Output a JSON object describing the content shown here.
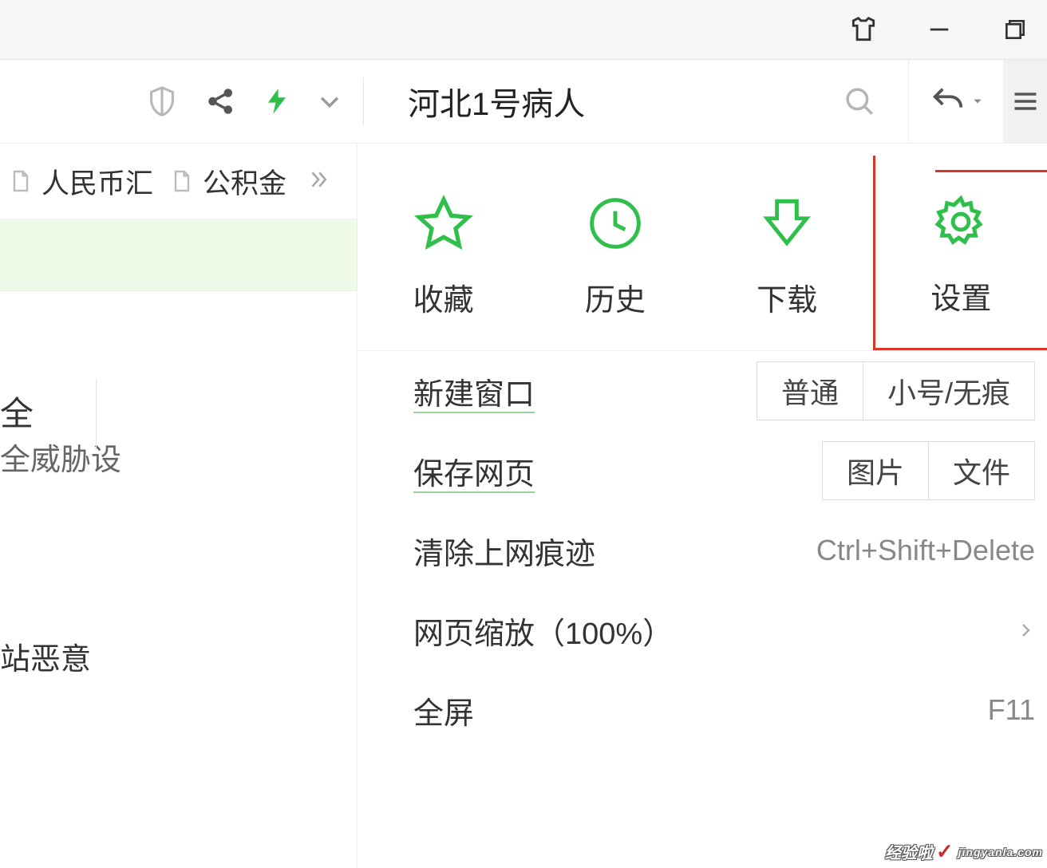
{
  "search": {
    "text": "河北1号病人"
  },
  "bookmarks": {
    "item1": "人民币汇",
    "item2": "公积金"
  },
  "side": {
    "heading_fragment": "全",
    "sub_fragment": "全威胁设",
    "lower_fragment": "站恶意"
  },
  "grid": {
    "favorites": "收藏",
    "history": "历史",
    "downloads": "下载",
    "settings": "设置"
  },
  "menu": {
    "new_window": {
      "label": "新建窗口",
      "opt_normal": "普通",
      "opt_incognito": "小号/无痕"
    },
    "save_page": {
      "label": "保存网页",
      "opt_image": "图片",
      "opt_file": "文件"
    },
    "clear_trace": {
      "label": "清除上网痕迹",
      "shortcut": "Ctrl+Shift+Delete"
    },
    "zoom": {
      "label": "网页缩放（100%）"
    },
    "fullscreen": {
      "label": "全屏",
      "shortcut": "F11"
    }
  },
  "watermark": {
    "main": "经验啦",
    "sub": "jingyanla.com"
  }
}
